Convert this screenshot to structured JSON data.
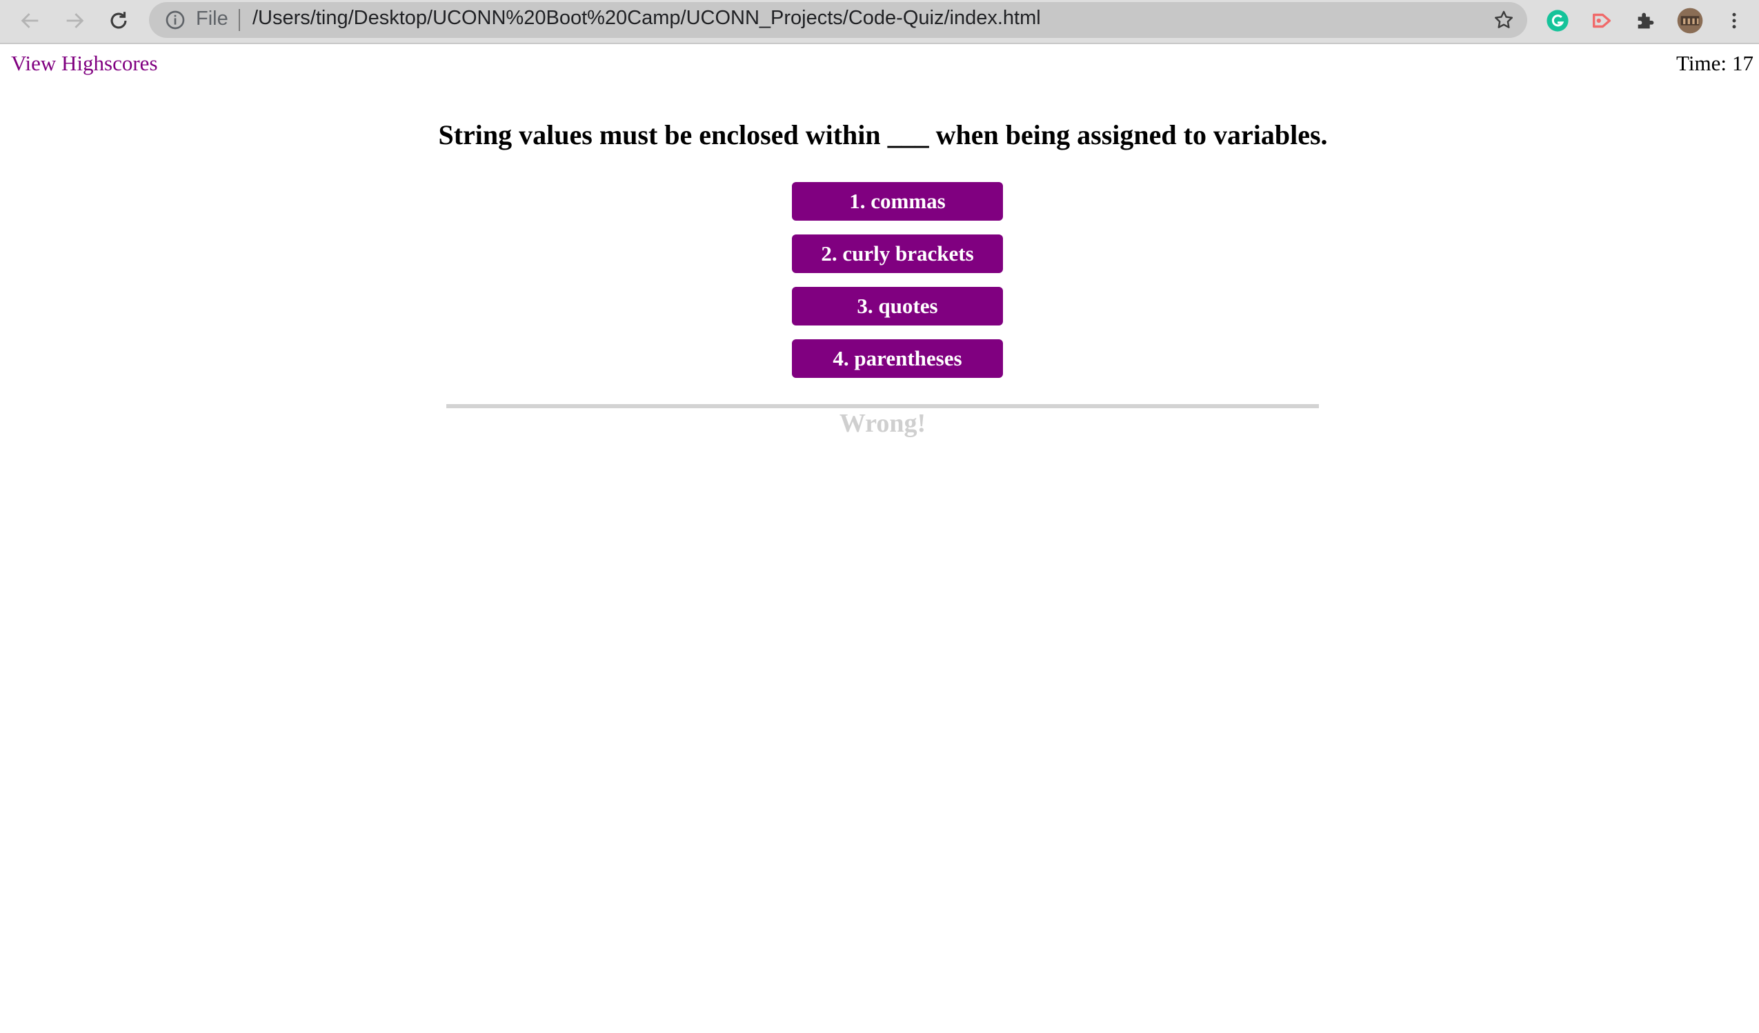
{
  "browser": {
    "scheme_label": "File",
    "url": "/Users/ting/Desktop/UCONN%20Boot%20Camp/UCONN_Projects/Code-Quiz/index.html",
    "icons": {
      "back": "arrow-left-icon",
      "forward": "arrow-right-icon",
      "reload": "reload-icon",
      "info": "info-icon",
      "bookmark": "star-icon",
      "grammarly": "grammarly-icon",
      "extension_red": "red-extension-icon",
      "extensions": "puzzle-icon",
      "profile": "avatar",
      "menu": "kebab-menu-icon"
    }
  },
  "header": {
    "highscores_label": "View Highscores",
    "timer_label": "Time:",
    "timer_value": "17"
  },
  "quiz": {
    "question": "String values must be enclosed within ___ when being assigned to variables.",
    "answers": [
      {
        "label": "1. commas"
      },
      {
        "label": "2. curly brackets"
      },
      {
        "label": "3. quotes"
      },
      {
        "label": "4. parentheses"
      }
    ],
    "feedback": "Wrong!"
  },
  "colors": {
    "accent": "#800080",
    "feedback": "#cfcfcf",
    "divider": "#d3d3d3",
    "chrome_bg": "#dedede",
    "omnibox_bg": "#c7c7c7"
  }
}
